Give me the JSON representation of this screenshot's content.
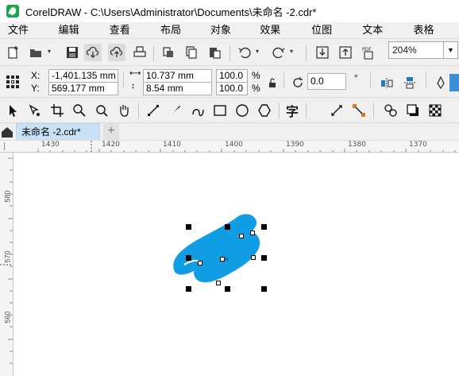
{
  "window": {
    "title": "CorelDRAW - C:\\Users\\Administrator\\Documents\\未命名 -2.cdr*"
  },
  "menu": [
    {
      "label": "文件(F)"
    },
    {
      "label": "编辑(E)"
    },
    {
      "label": "查看(V)"
    },
    {
      "label": "布局(L)"
    },
    {
      "label": "对象(J)"
    },
    {
      "label": "效果(C)"
    },
    {
      "label": "位图(B)"
    },
    {
      "label": "文本(X)"
    },
    {
      "label": "表格(T)"
    }
  ],
  "toolbar": {
    "zoom_value": "204%",
    "icons": [
      "new-document-icon",
      "open-folder-icon",
      "save-icon",
      "cloud-download-icon",
      "cloud-upload-icon",
      "print-icon",
      "cut-icon",
      "copy-icon",
      "paste-icon",
      "undo-icon",
      "redo-icon",
      "import-icon",
      "export-icon",
      "publish-pdf-icon"
    ],
    "pdf_label": "PDF"
  },
  "property_bar": {
    "x_label": "X:",
    "y_label": "Y:",
    "x_value": "-1,401.135 mm",
    "y_value": "569.177 mm",
    "width_value": "10.737 mm",
    "height_value": "8.54 mm",
    "scale_w": "100.0",
    "scale_h": "100.0",
    "percent_w": "%",
    "percent_h": "%",
    "rotation": "0.0",
    "degree_symbol": "°"
  },
  "toolbox": {
    "icons": [
      "pick-tool-icon",
      "shape-tool-icon",
      "crop-tool-icon",
      "zoom-tool-icon",
      "search-tool-icon",
      "pan-tool-icon",
      "freehand-tool-icon",
      "artistic-media-icon",
      "smart-draw-icon",
      "rectangle-tool-icon",
      "ellipse-tool-icon",
      "polygon-tool-icon",
      "text-tool-icon",
      "connector-tool-icon",
      "dimension-tool-icon",
      "interactive-tool-icon",
      "drop-shadow-icon",
      "transparency-icon"
    ],
    "text_tool_glyph": "字"
  },
  "document_tabs": [
    {
      "label": "未命名 -2.cdr*",
      "active": true
    }
  ],
  "add_tab_symbol": "+",
  "horizontal_ruler": {
    "labels": [
      "1430",
      "1420",
      "1410",
      "1400",
      "1390",
      "1380",
      "1370"
    ]
  },
  "vertical_ruler": {
    "labels": [
      "580",
      "570",
      "560"
    ]
  },
  "shape": {
    "fill_color": "#0f9ee3",
    "description_name": "selected-blue-shape"
  },
  "colors": {
    "accent_tab": "#c8e1f7",
    "shape_blue": "#0f9ee3"
  }
}
